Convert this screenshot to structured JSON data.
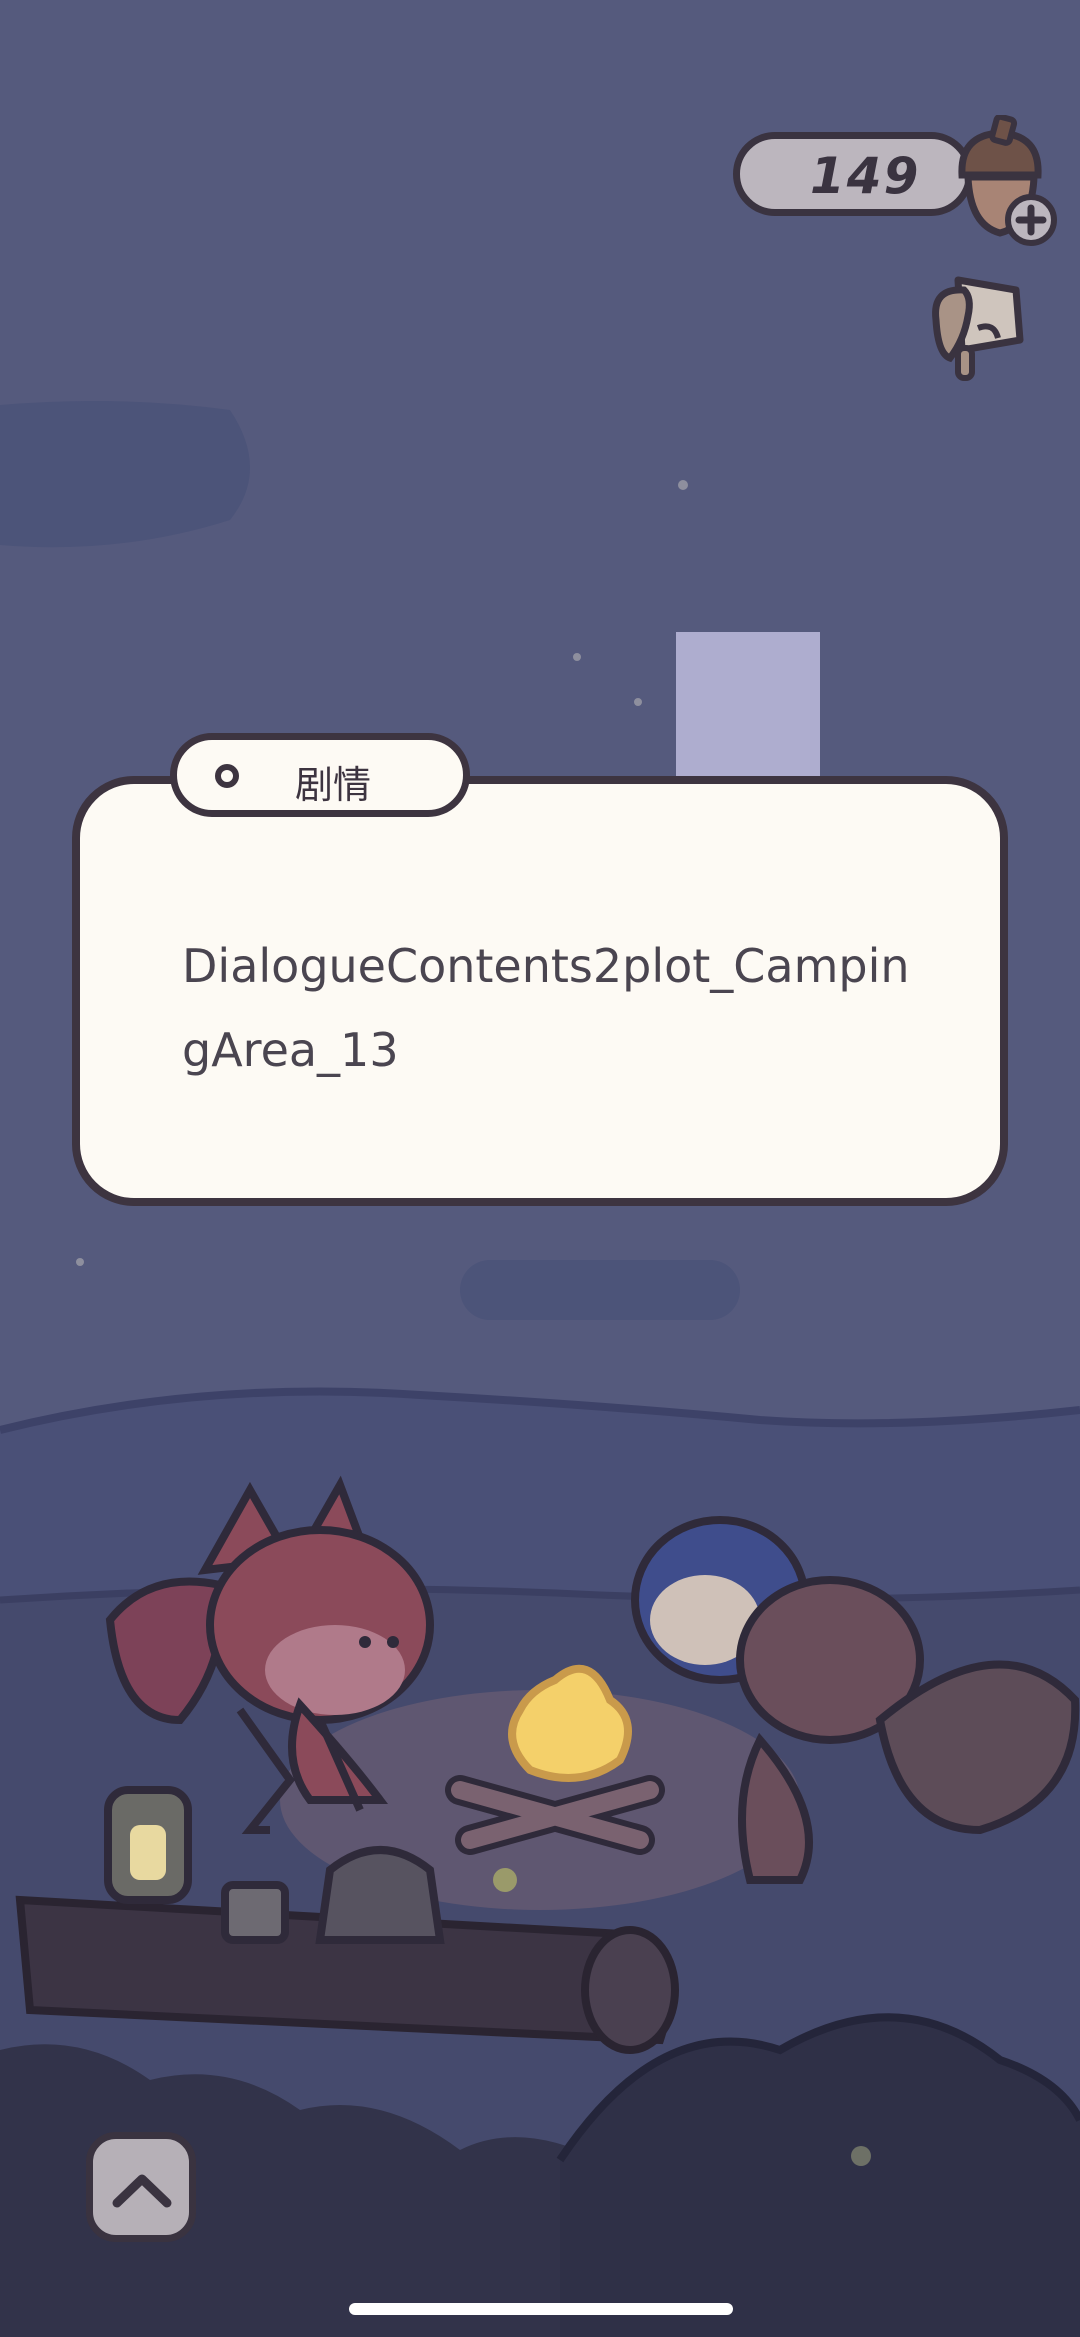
{
  "hud": {
    "acorn_count": "149",
    "acorn_icon": "acorn-icon",
    "add_icon": "plus-icon",
    "hint_icon": "wing-scroll-icon"
  },
  "dialog": {
    "tab_label": "剧情",
    "text": "DialogueContents2plot_CampingArea_13"
  },
  "controls": {
    "expand_icon": "chevron-up-icon"
  },
  "colors": {
    "sky": "#555a7d",
    "panel": "#fdfaf4",
    "outline": "#3d3440",
    "fire": "#f4d06a"
  }
}
